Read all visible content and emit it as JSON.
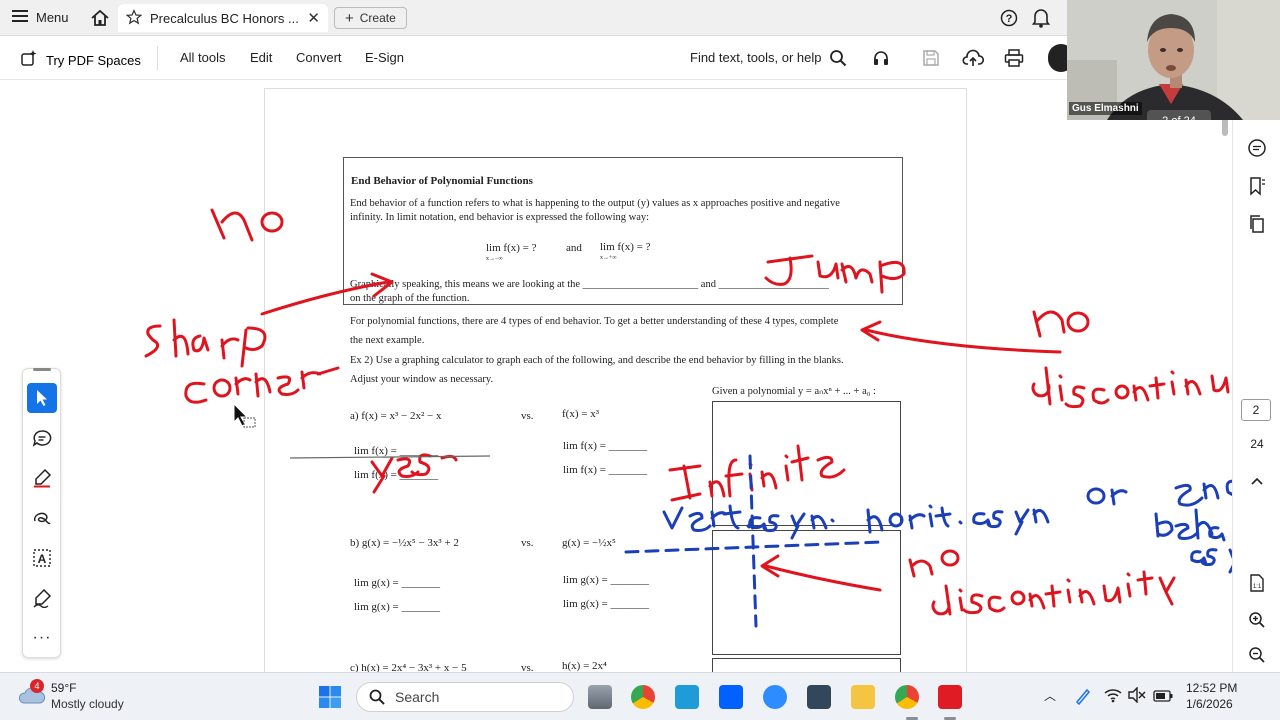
{
  "tabbar": {
    "menu_label": "Menu",
    "tab_title": "Precalculus BC Honors ...",
    "create_label": "Create"
  },
  "toolbar": {
    "try_pdf_spaces": "Try PDF Spaces",
    "all_tools": "All tools",
    "edit": "Edit",
    "convert": "Convert",
    "esign": "E-Sign",
    "find_placeholder": "Find text, tools, or help"
  },
  "webcam": {
    "participant_name": "Gus Elmashni",
    "page_counter": "2 of 24"
  },
  "right_rail": {
    "page_current": "2",
    "page_total": "24"
  },
  "document": {
    "heading": "End Behavior of Polynomial Functions",
    "intro_line1": "End behavior of a function refers to what is happening to the output (y) values as x approaches positive and negative",
    "intro_line2": "infinity.  In limit notation, end behavior is expressed the following way:",
    "limit_eq_left": "lim f(x) = ?",
    "limit_and": "and",
    "limit_eq_right": "lim f(x) = ?",
    "lim_sub_left": "x→−∞",
    "lim_sub_right": "x→+∞",
    "graph_line1": "Graphically speaking, this means we are looking at the ______________________ and _____________________",
    "graph_line2": "on the graph of the function.",
    "poly_line1": "For polynomial functions, there are 4 types of end behavior.  To get a better understanding of these 4 types, complete",
    "poly_line2": "the next example.",
    "ex2_line1": "Ex 2)  Use a graphing calculator to graph each of the following, and describe the end behavior by filling in the blanks.",
    "ex2_line2": "Adjust your window as necessary.",
    "given_poly": "Given a polynomial  y = aₙxⁿ + ... + a₀ :",
    "part_a": "a)  f(x) = x³ − 2x² − x",
    "vs": "vs.",
    "part_a_vs": "f(x) = x³",
    "lim_f_blank": "lim f(x) = _______",
    "part_b": "b)  g(x) = −½x⁵ − 3x³ + 2",
    "part_b_vs": "g(x) = −½x⁵",
    "lim_g_blank": "lim g(x) = _______",
    "part_c": "c)  h(x) = 2x⁴ − 3x³ + x − 5",
    "part_c_vs": "h(x) = 2x⁴"
  },
  "taskbar": {
    "weather_temp": "59°F",
    "weather_desc": "Mostly cloudy",
    "weather_badge": "4",
    "search_label": "Search",
    "time": "12:52 PM",
    "date": "1/6/2026"
  },
  "colors": {
    "ink_red": "#e0141e",
    "ink_blue": "#1a3fb8",
    "accent_blue": "#1473e6",
    "adobe_red": "#e01b24"
  }
}
